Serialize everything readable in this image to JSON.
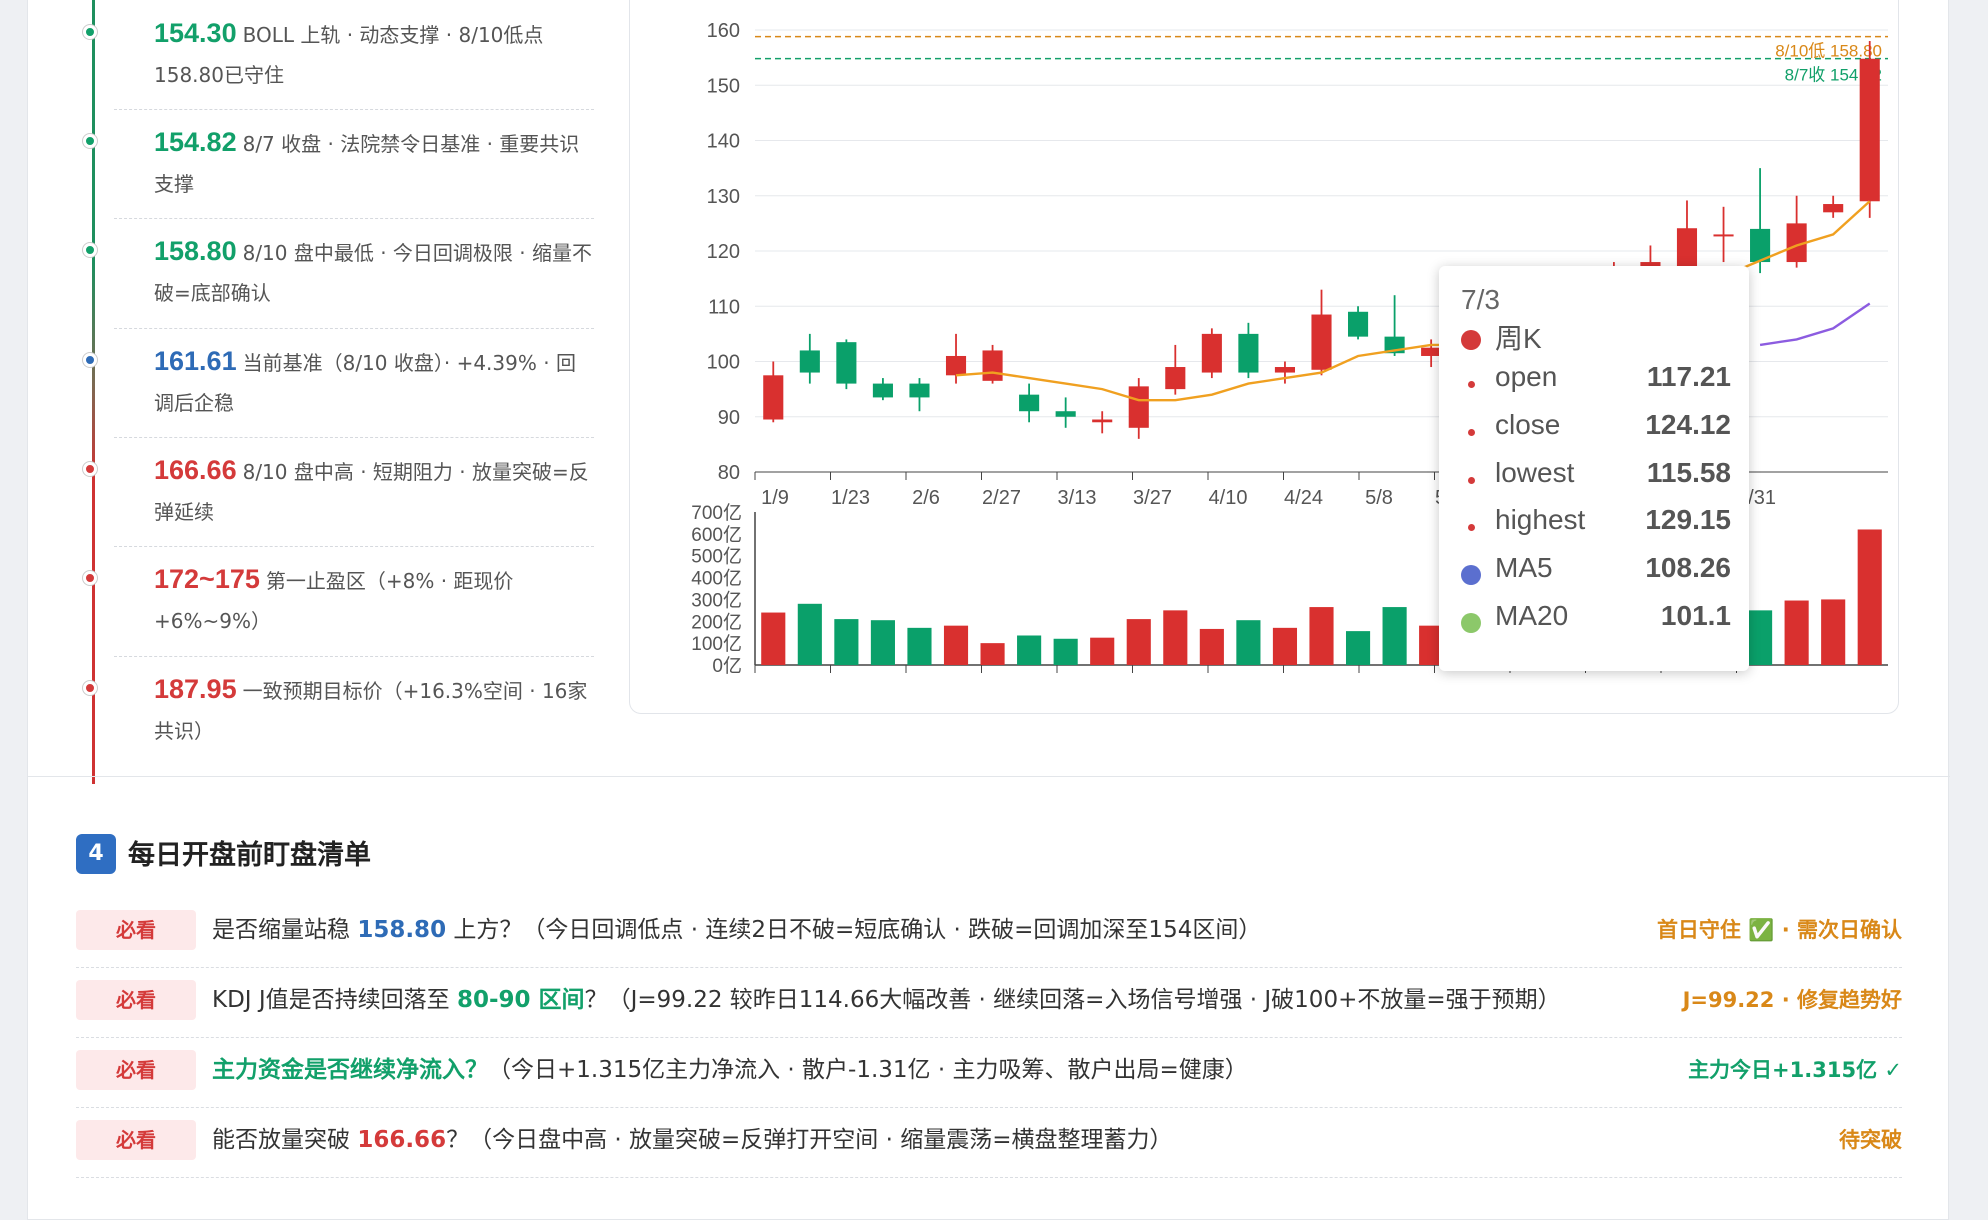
{
  "levels": [
    {
      "price": "154.30",
      "desc": "BOLL 上轨 · 动态支撑 · 8/10低点158.80已守住",
      "color": "#12a06a"
    },
    {
      "price": "154.82",
      "desc": "8/7 收盘 · 法院禁令日基准 · 重要共识支撑",
      "color": "#12a06a"
    },
    {
      "price": "158.80",
      "desc": "8/10 盘中最低 · 今日回调极限 · 缩量不破=底部确认",
      "color": "#12a06a"
    },
    {
      "price": "161.61",
      "desc": "当前基准（8/10 收盘）· +4.39% · 回调后企稳",
      "color": "#2e6bb6"
    },
    {
      "price": "166.66",
      "desc": "8/10 盘中高 · 短期阻力 · 放量突破=反弹延续",
      "color": "#d43a3a"
    },
    {
      "price": "172~175",
      "desc": "第一止盈区（+8% · 距现价+6%~9%）",
      "color": "#d43a3a"
    },
    {
      "price": "187.95",
      "desc": "一致预期目标价（+16.3%空间 · 16家共识）",
      "color": "#d43a3a"
    }
  ],
  "tooltip": {
    "date": "7/3",
    "series": "周K",
    "rows": [
      {
        "label": "open",
        "value": "117.21"
      },
      {
        "label": "close",
        "value": "124.12"
      },
      {
        "label": "lowest",
        "value": "115.58"
      },
      {
        "label": "highest",
        "value": "129.15"
      }
    ],
    "ma5": {
      "label": "MA5",
      "value": "108.26",
      "color": "#5b6fcf"
    },
    "ma20": {
      "label": "MA20",
      "value": "101.1",
      "color": "#8cc86a"
    }
  },
  "section": {
    "num": "4",
    "title": "每日开盘前盯盘清单"
  },
  "checklist": [
    {
      "tag": "必看",
      "pre": "是否缩量站稳 ",
      "hl": "158.80",
      "hl_color": "#2e6bb6",
      "post": " 上方？（今日回调低点 · 连续2日不破=短底确认 · 跌破=回调加深至154区间）",
      "right": "首日守住 ✅ · 需次日确认",
      "right_color": "#d98818"
    },
    {
      "tag": "必看",
      "pre": "KDJ J值是否持续回落至 ",
      "hl": "80-90 区间",
      "hl_color": "#12a06a",
      "post": "？（J=99.22 较昨日114.66大幅改善 · 继续回落=入场信号增强 · J破100+不放量=强于预期）",
      "right": "J=99.22 · 修复趋势好",
      "right_color": "#d98818"
    },
    {
      "tag": "必看",
      "pre": "",
      "hl": "主力资金是否继续净流入？",
      "hl_color": "#12a06a",
      "post": "（今日+1.315亿主力净流入 · 散户-1.31亿 · 主力吸筹、散户出局=健康）",
      "right": "主力今日+1.315亿 ✓",
      "right_color": "#12a06a"
    },
    {
      "tag": "必看",
      "pre": "能否放量突破 ",
      "hl": "166.66",
      "hl_color": "#d43a3a",
      "post": "？（今日盘中高 · 放量突破=反弹打开空间 · 缩量震荡=横盘整理蓄力）",
      "right": "待突破",
      "right_color": "#d98818"
    }
  ],
  "chart_data": {
    "type": "candlestick",
    "title": "",
    "price_axis": {
      "min": 80,
      "max": 160,
      "ticks": [
        80,
        90,
        100,
        110,
        120,
        130,
        140,
        150,
        160
      ]
    },
    "volume_axis": {
      "min": 0,
      "max": 700,
      "ticks": [
        "0亿",
        "100亿",
        "200亿",
        "300亿",
        "400亿",
        "500亿",
        "600亿",
        "700亿"
      ]
    },
    "x_ticks": [
      "1/9",
      "1/23",
      "2/6",
      "2/27",
      "3/13",
      "3/27",
      "4/10",
      "4/24",
      "5/8",
      "5/22",
      "",
      "",
      "",
      "7/31"
    ],
    "ref_lines": [
      {
        "value": 158.8,
        "label": "8/10低 158.80",
        "color": "#d98818"
      },
      {
        "value": 154.82,
        "label": "8/7收 154.82",
        "color": "#12a06a"
      }
    ],
    "candles": [
      [
        89.5,
        97.5,
        89,
        100,
        240
      ],
      [
        102,
        98,
        96,
        105,
        280
      ],
      [
        103.5,
        96,
        95,
        104,
        210
      ],
      [
        96,
        93.5,
        93,
        97,
        205
      ],
      [
        96,
        93.5,
        91,
        97,
        170
      ],
      [
        97.5,
        101,
        96,
        105,
        180
      ],
      [
        96.5,
        102,
        96,
        103,
        100
      ],
      [
        94,
        91,
        89,
        96,
        135
      ],
      [
        91,
        90,
        88,
        93.5,
        120
      ],
      [
        89,
        89.5,
        87,
        91,
        125
      ],
      [
        88,
        95.5,
        86,
        97,
        210
      ],
      [
        95,
        99,
        94,
        103,
        250
      ],
      [
        98,
        105,
        97,
        106,
        165
      ],
      [
        105,
        98,
        97,
        107,
        205
      ],
      [
        98,
        99,
        96,
        100,
        170
      ],
      [
        98.5,
        108.5,
        97.5,
        113,
        265
      ],
      [
        109,
        104.5,
        104,
        110,
        155
      ],
      [
        104.5,
        101.5,
        101,
        112,
        265
      ],
      [
        101,
        102.5,
        99,
        104,
        180
      ],
      [
        103,
        103.5,
        101,
        105,
        140
      ],
      [
        105,
        104,
        102,
        107,
        160
      ],
      [
        106,
        107,
        104,
        110,
        190
      ],
      [
        107,
        110,
        106,
        114,
        230
      ],
      [
        110,
        112,
        108,
        118,
        260
      ],
      [
        117.21,
        118,
        115.58,
        121,
        280
      ],
      [
        117.21,
        124.12,
        115.58,
        129.15,
        240
      ],
      [
        123,
        123,
        118,
        128,
        230
      ],
      [
        124,
        118,
        116,
        135,
        250
      ],
      [
        118,
        125,
        117,
        130,
        295
      ],
      [
        127,
        128.5,
        126,
        130,
        300
      ],
      [
        129,
        154.8,
        126,
        158,
        620
      ]
    ],
    "ma20": [
      null,
      null,
      null,
      null,
      null,
      97.5,
      98,
      97,
      96,
      95,
      93,
      93,
      94,
      96,
      97,
      98,
      101,
      102,
      103,
      103,
      103.5,
      104,
      104.5,
      null,
      null,
      null,
      null,
      null,
      121,
      123,
      129
    ],
    "ma5_tail": [
      null,
      null,
      null,
      null,
      null,
      null,
      null,
      null,
      null,
      null,
      null,
      null,
      null,
      null,
      null,
      null,
      null,
      null,
      null,
      null,
      null,
      null,
      null,
      null,
      null,
      null,
      null,
      103,
      104,
      106,
      110.5
    ]
  }
}
